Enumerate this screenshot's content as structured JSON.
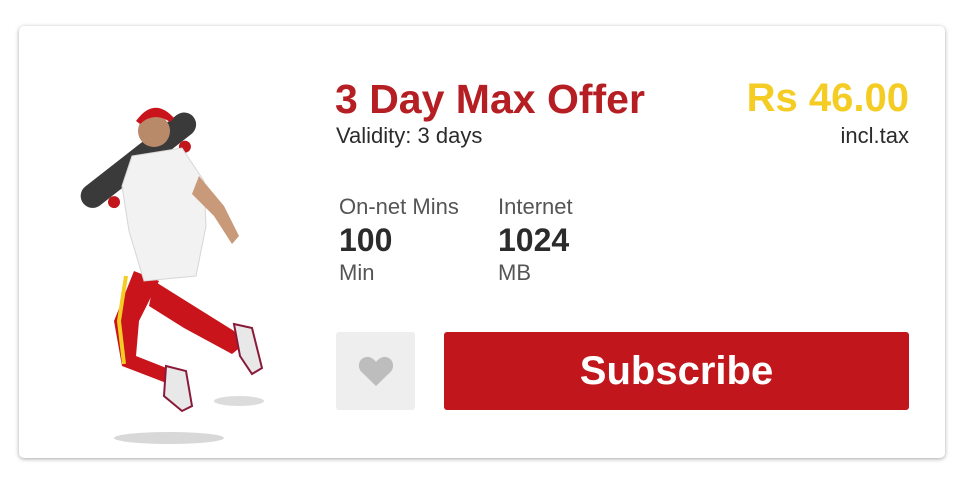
{
  "offer": {
    "title": "3 Day Max Offer",
    "validity": "Validity: 3 days",
    "price": "Rs 46.00",
    "tax_note": "incl.tax"
  },
  "stats": [
    {
      "label": "On-net Mins",
      "value": "100",
      "unit": "Min"
    },
    {
      "label": "Internet",
      "value": "1024",
      "unit": "MB"
    }
  ],
  "actions": {
    "subscribe_label": "Subscribe",
    "favorite_icon": "heart-icon"
  },
  "colors": {
    "title": "#b51e23",
    "price": "#f4cc23",
    "button": "#c0161c",
    "favorite_bg": "#eeeeee",
    "heart": "#bdbdbd"
  }
}
